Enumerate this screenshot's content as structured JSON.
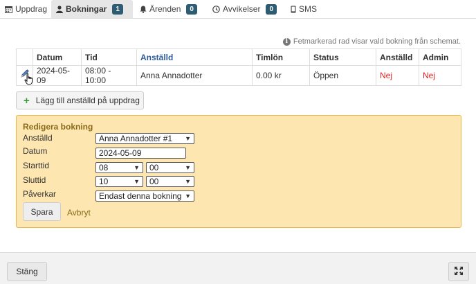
{
  "tabs": [
    {
      "label": "Uppdrag",
      "icon": "calendar-icon"
    },
    {
      "label": "Bokningar",
      "icon": "user-icon",
      "badge": "1"
    },
    {
      "label": "Ärenden",
      "icon": "bell-icon",
      "badge": "0"
    },
    {
      "label": "Avvikelser",
      "icon": "clock-icon",
      "badge": "0"
    },
    {
      "label": "SMS",
      "icon": "phone-icon"
    }
  ],
  "info_text": "Fetmarkerad rad visar vald bokning från schemat.",
  "table": {
    "headers": [
      "Datum",
      "Tid",
      "Anställd",
      "Timlön",
      "Status",
      "Anställd",
      "Admin"
    ],
    "rows": [
      {
        "datum": "2024-05-09",
        "tid": "08:00 - 10:00",
        "anstalld": "Anna Annadotter",
        "timlon": "0.00 kr",
        "status": "Öppen",
        "anstalld_bekr": "Nej",
        "admin": "Nej"
      }
    ]
  },
  "add_button_label": "Lägg till anställd på uppdrag",
  "edit": {
    "title": "Redigera bokning",
    "labels": {
      "anstalld": "Anställd",
      "datum": "Datum",
      "starttid": "Starttid",
      "sluttid": "Sluttid",
      "paverkar": "Påverkar"
    },
    "anstalld_value": "Anna Annadotter #1",
    "datum_value": "2024-05-09",
    "start_hour": "08",
    "start_min": "00",
    "end_hour": "10",
    "end_min": "00",
    "paverkar_value": "Endast denna bokning",
    "save_label": "Spara",
    "cancel_label": "Avbryt"
  },
  "footer": {
    "close_label": "Stäng"
  },
  "colors": {
    "badge": "#2e5c73",
    "panel_bg": "#fde6b0",
    "panel_border": "#e8b84a",
    "no_red": "#e02020",
    "link_brown": "#8a6a1a"
  }
}
